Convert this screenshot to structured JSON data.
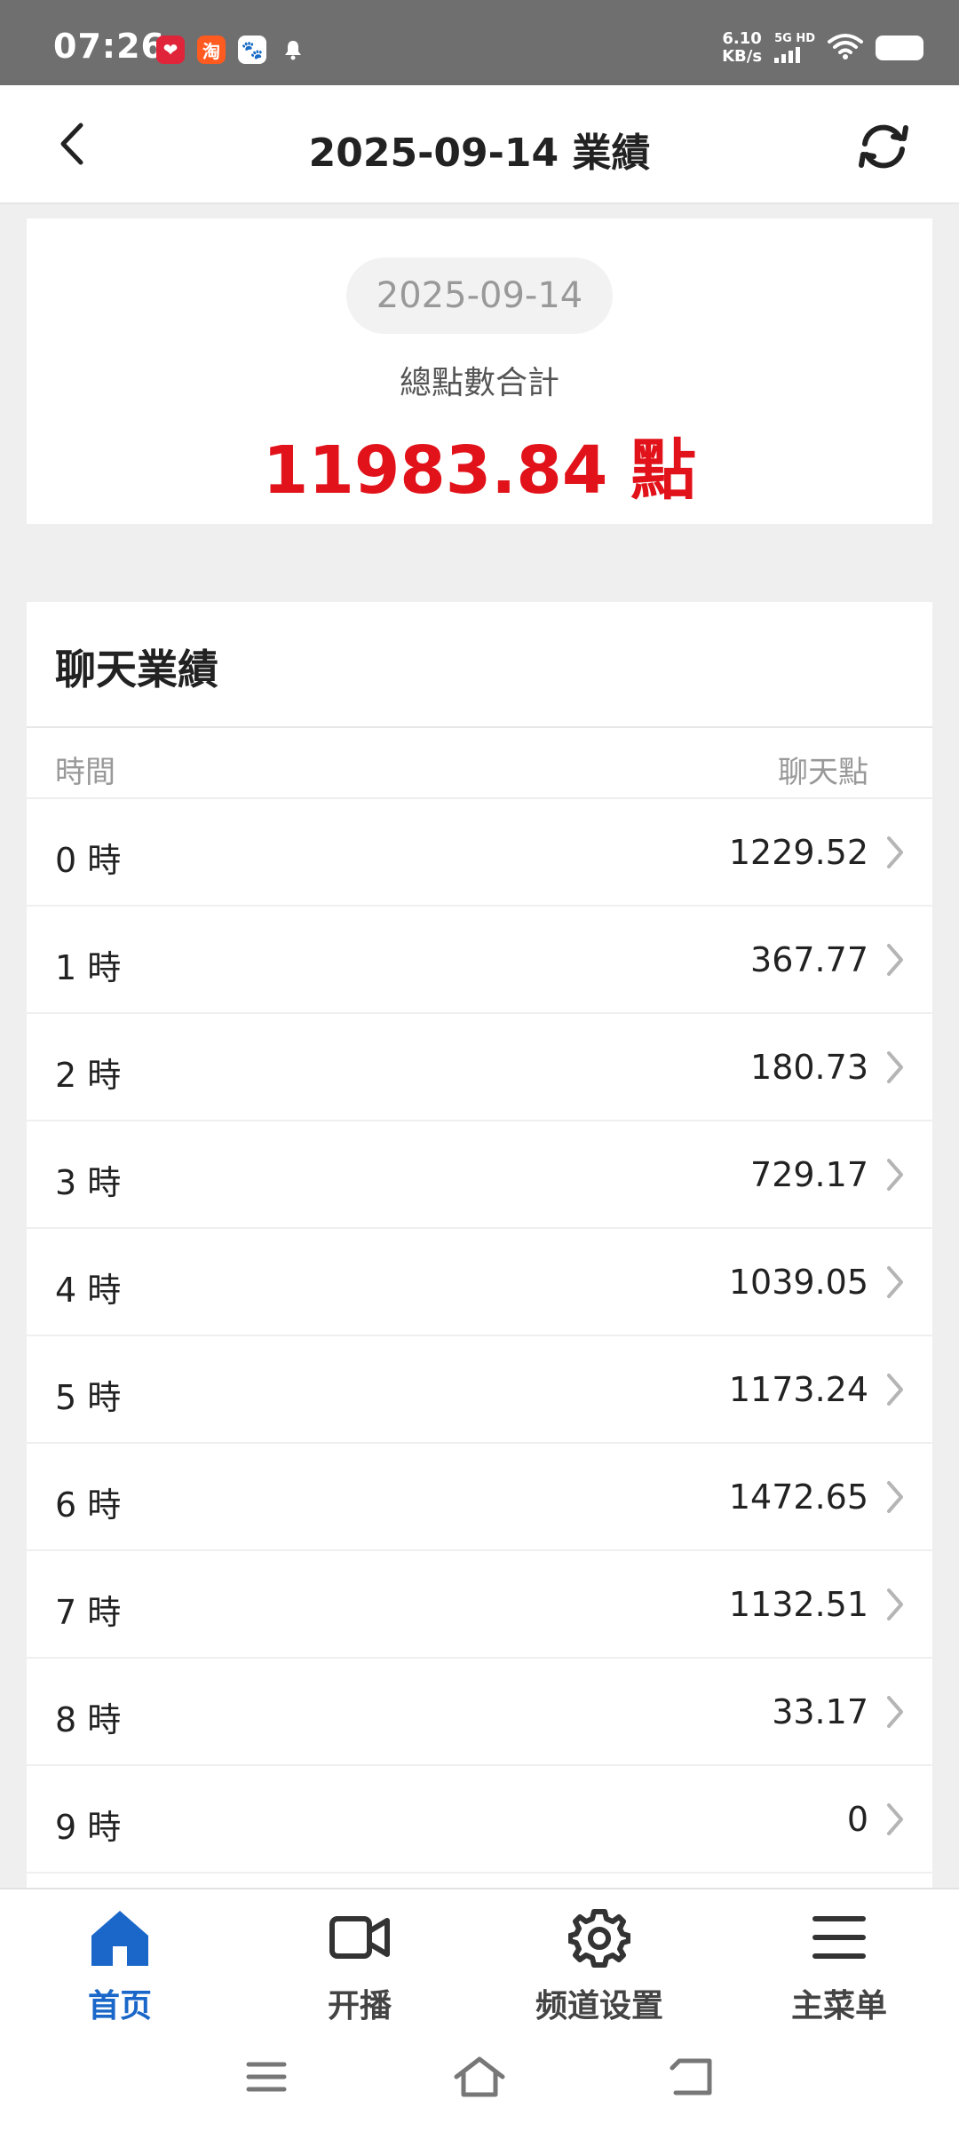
{
  "status_bar": {
    "time": "07:26",
    "apps": [
      {
        "icon": "pinduoduo-app-icon",
        "glyph": "❤"
      },
      {
        "icon": "taobao-app-icon",
        "glyph": "淘"
      },
      {
        "icon": "baidu-app-icon",
        "glyph": "🐾"
      }
    ],
    "net_speed_value": "6.10",
    "net_speed_unit": "KB/s",
    "signal_label": "5G HD"
  },
  "header": {
    "title": "2025-09-14 業績",
    "back_icon": "back-chevron-icon",
    "refresh_icon": "refresh-icon"
  },
  "summary": {
    "date": "2025-09-14",
    "total_label": "總點數合計",
    "total_value": "11983.84 點",
    "accent_color": "#e1121a"
  },
  "chat_performance": {
    "title": "聊天業績",
    "columns": {
      "time": "時間",
      "points": "聊天點"
    },
    "rows": [
      {
        "hour": "0 時",
        "points": "1229.52"
      },
      {
        "hour": "1 時",
        "points": "367.77"
      },
      {
        "hour": "2 時",
        "points": "180.73"
      },
      {
        "hour": "3 時",
        "points": "729.17"
      },
      {
        "hour": "4 時",
        "points": "1039.05"
      },
      {
        "hour": "5 時",
        "points": "1173.24"
      },
      {
        "hour": "6 時",
        "points": "1472.65"
      },
      {
        "hour": "7 時",
        "points": "1132.51"
      },
      {
        "hour": "8 時",
        "points": "33.17"
      },
      {
        "hour": "9 時",
        "points": "0"
      }
    ]
  },
  "tabbar": {
    "active_color": "#1a67c9",
    "tabs": [
      {
        "label": "首页",
        "icon": "home-icon",
        "active": true
      },
      {
        "label": "开播",
        "icon": "video-camera-icon",
        "active": false
      },
      {
        "label": "频道设置",
        "icon": "gear-icon",
        "active": false
      },
      {
        "label": "主菜单",
        "icon": "menu-icon",
        "active": false
      }
    ]
  }
}
